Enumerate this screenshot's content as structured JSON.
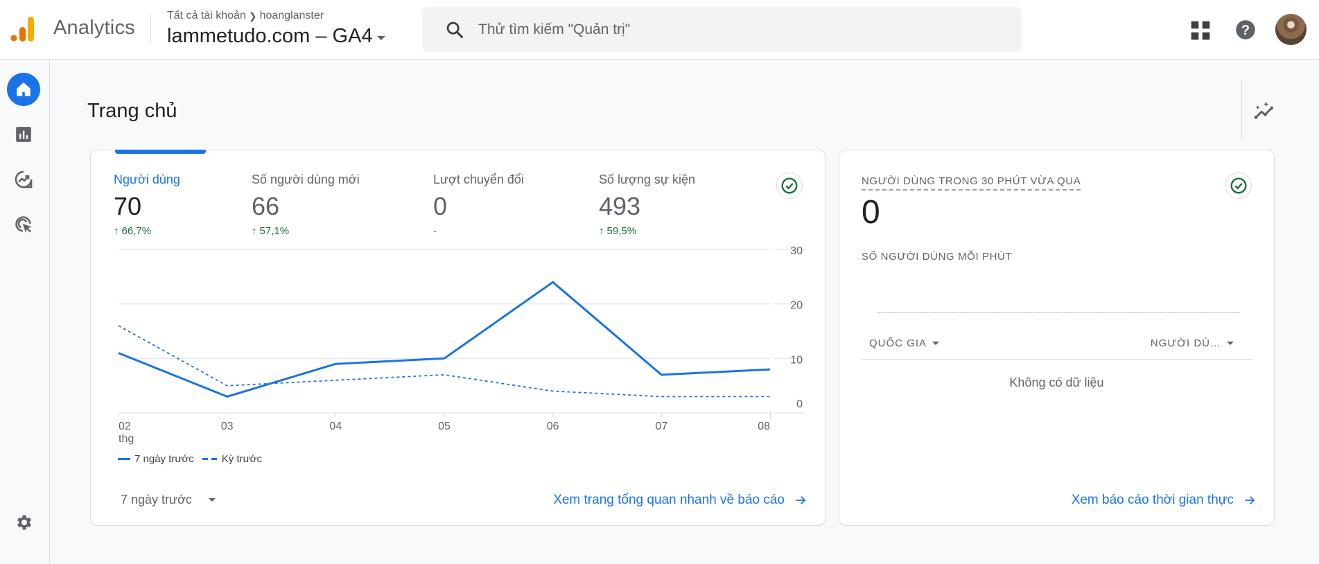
{
  "header": {
    "app_name": "Analytics",
    "breadcrumb": [
      "Tất cả tài khoản",
      "hoanglanster"
    ],
    "property_name": "lammetudo.com – GA4",
    "search_placeholder": "Thử tìm kiếm \"Quản trị\"",
    "icons": {
      "logo": "analytics-logo",
      "search": "search-icon",
      "apps": "apps-grid-icon",
      "help": "help-icon",
      "avatar": "user-avatar"
    }
  },
  "sidebar": {
    "items": [
      {
        "name": "home",
        "icon": "home-icon",
        "active": true
      },
      {
        "name": "reports",
        "icon": "bar-chart-icon",
        "active": false
      },
      {
        "name": "explore",
        "icon": "explore-trend-icon",
        "active": false
      },
      {
        "name": "advertising",
        "icon": "advertising-cursor-icon",
        "active": false
      }
    ],
    "footer_item": {
      "name": "admin",
      "icon": "gear-icon"
    }
  },
  "page": {
    "title": "Trang chủ",
    "insights_icon": "insights-sparkle-icon"
  },
  "overview_card": {
    "metrics": [
      {
        "label": "Người dùng",
        "value": "70",
        "delta": "66,7%",
        "direction": "up",
        "active": true
      },
      {
        "label": "Số người dùng mới",
        "value": "66",
        "delta": "57,1%",
        "direction": "up",
        "active": false
      },
      {
        "label": "Lượt chuyển đổi",
        "value": "0",
        "delta": "-",
        "direction": "none",
        "active": false
      },
      {
        "label": "Số lượng sự kiện",
        "value": "493",
        "delta": "59,5%",
        "direction": "up",
        "active": false
      }
    ],
    "date_range": "7 ngày trước",
    "link": "Xem trang tổng quan nhanh về báo cáo"
  },
  "chart_data": {
    "type": "line",
    "title": "",
    "xlabel": "",
    "ylabel": "",
    "categories": [
      "02",
      "03",
      "04",
      "05",
      "06",
      "07",
      "08"
    ],
    "x_sublabel_first": "thg",
    "series": [
      {
        "name": "7 ngày trước",
        "style": "solid",
        "color": "#1a73e8",
        "values": [
          11,
          3,
          9,
          10,
          24,
          7,
          8
        ]
      },
      {
        "name": "Kỳ trước",
        "style": "dashed",
        "color": "#1a73e8",
        "values": [
          16,
          5,
          6,
          7,
          4,
          3,
          3
        ]
      }
    ],
    "ylim": [
      0,
      30
    ],
    "yticks": [
      0,
      10,
      20,
      30
    ],
    "y_axis_side": "right",
    "grid": true,
    "legend": "bottom-left"
  },
  "realtime_card": {
    "title": "NGƯỜI DÙNG TRONG 30 PHÚT VỪA QUA",
    "value": "0",
    "subtitle": "SỐ NGƯỜI DÙNG MỖI PHÚT",
    "table": {
      "columns": [
        "QUỐC GIA",
        "NGƯỜI DÙ…"
      ],
      "empty_text": "Không có dữ liệu"
    },
    "link": "Xem báo cáo thời gian thực"
  }
}
